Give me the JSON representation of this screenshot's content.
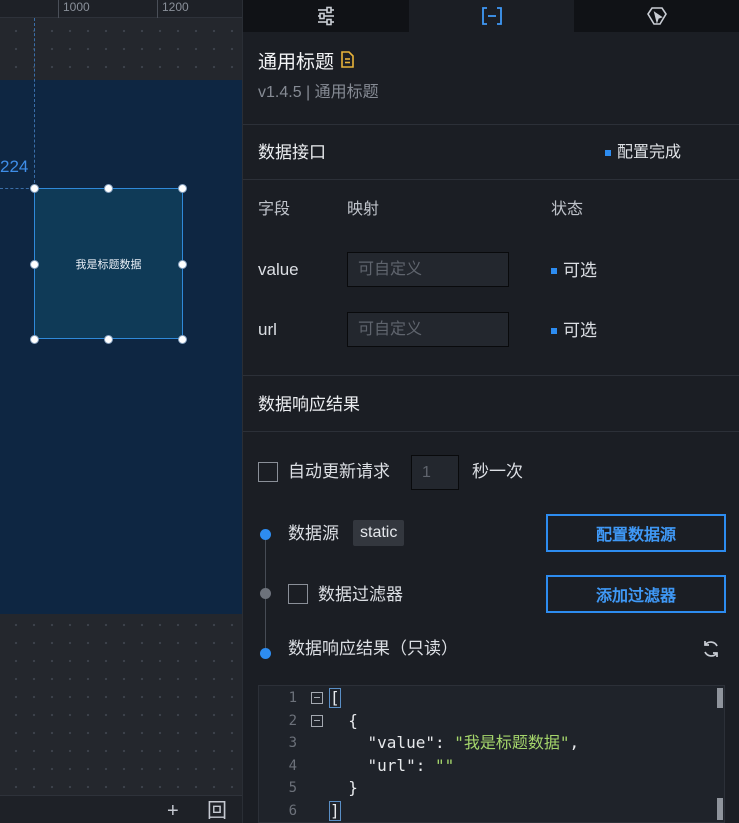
{
  "canvas": {
    "ruler_labels": [
      "1000",
      "1200"
    ],
    "coordinate_label": "224",
    "widget_text": "我是标题数据",
    "footer_buttons": {
      "add": "+",
      "fit": "回"
    }
  },
  "tabs": [
    {
      "name": "settings",
      "icon": "sliders-icon",
      "active": false
    },
    {
      "name": "data",
      "icon": "data-bracket-icon",
      "active": true
    },
    {
      "name": "interaction",
      "icon": "interaction-icon",
      "active": false
    }
  ],
  "component": {
    "title": "通用标题",
    "version_line": "v1.4.5 | 通用标题"
  },
  "data_interface": {
    "section_title": "数据接口",
    "status": "配置完成",
    "columns": {
      "field": "字段",
      "mapping": "映射",
      "status": "状态"
    },
    "fields": [
      {
        "name": "value",
        "placeholder": "可自定义",
        "status": "可选"
      },
      {
        "name": "url",
        "placeholder": "可自定义",
        "status": "可选"
      }
    ]
  },
  "response": {
    "section_title": "数据响应结果",
    "auto_update_label": "自动更新请求",
    "interval_placeholder": "1",
    "interval_suffix": "秒一次",
    "datasource_label": "数据源",
    "datasource_tag": "static",
    "config_datasource_button": "配置数据源",
    "filter_label": "数据过滤器",
    "add_filter_button": "添加过滤器",
    "result_label": "数据响应结果（只读）"
  },
  "code": {
    "line_numbers": [
      "1",
      "2",
      "3",
      "4",
      "5",
      "6"
    ],
    "line1": "[",
    "line2": "  {",
    "line3_key": "    \"value\": ",
    "line3_val": "\"我是标题数据\"",
    "line3_end": ",",
    "line4_key": "    \"url\": ",
    "line4_val": "\"\"",
    "line5": "  }",
    "line6": "]"
  },
  "colors": {
    "accent": "#2d8cf0",
    "canvas_screen": "#0e2642",
    "panel_bg": "#1b1e24"
  }
}
